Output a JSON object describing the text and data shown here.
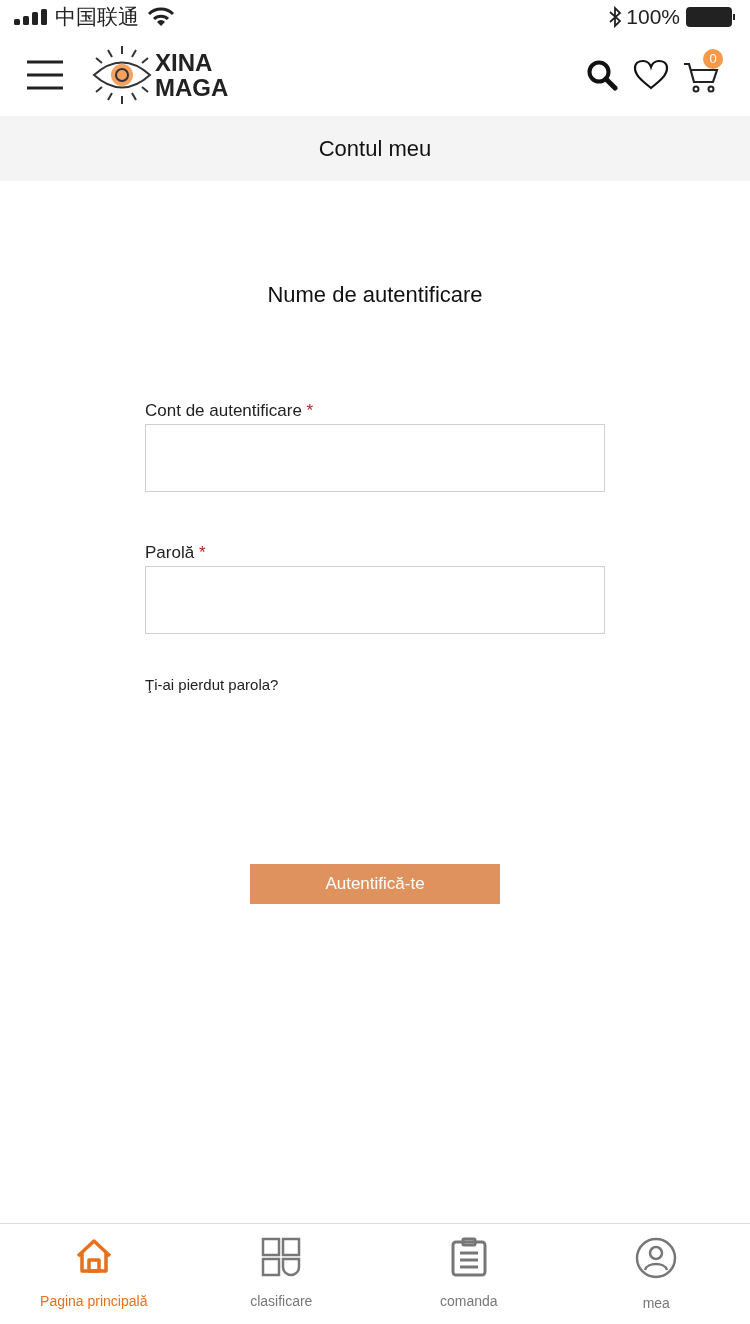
{
  "status_bar": {
    "carrier": "中国联通",
    "battery": "100%"
  },
  "header": {
    "logo": [
      "XINA",
      "MAGA"
    ],
    "cart_count": "0"
  },
  "page_title": "Contul meu",
  "form": {
    "heading": "Nume de autentificare",
    "fields": [
      {
        "label": "Cont de autentificare",
        "required_mark": "*"
      },
      {
        "label": "Parolă",
        "required_mark": "*"
      }
    ],
    "forgot_link": "Ţi-ai pierdut parola?",
    "submit": "Autentifică-te"
  },
  "tab_bar": [
    {
      "kind": "home",
      "label": "Pagina principală",
      "selected": true
    },
    {
      "kind": "grid",
      "label": "clasificare",
      "selected": false
    },
    {
      "kind": "clipboard",
      "label": "comanda",
      "selected": false
    },
    {
      "kind": "user",
      "label": "mea",
      "selected": false
    }
  ]
}
